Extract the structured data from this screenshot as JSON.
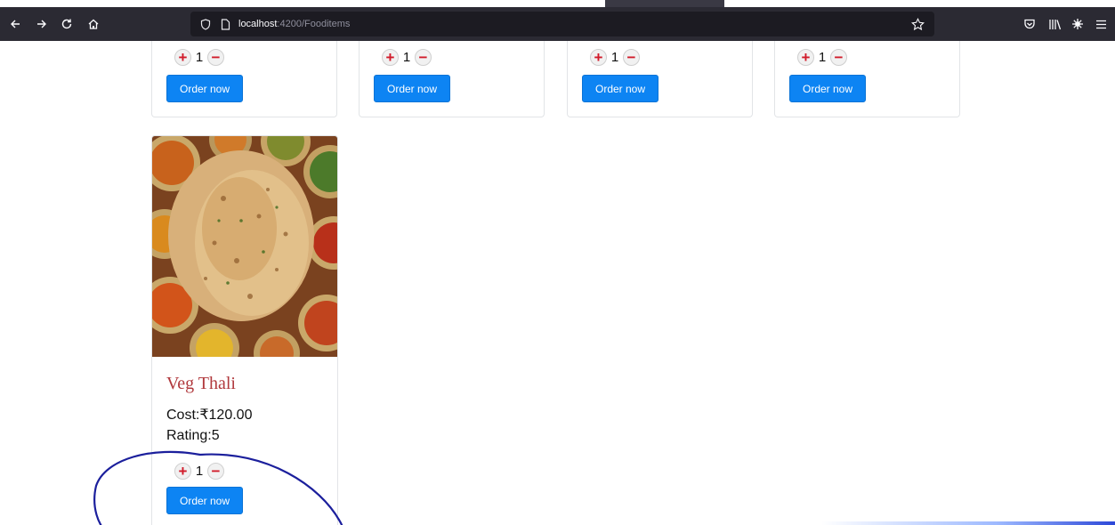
{
  "browser": {
    "url_host": "localhost",
    "url_rest": ":4200/Fooditems",
    "icons": {
      "back": "back-arrow-icon",
      "forward": "forward-arrow-icon",
      "reload": "reload-icon",
      "home": "home-icon",
      "tracking_protection": "shield-icon",
      "page_info": "page-icon",
      "bookmark": "star-icon",
      "pocket": "pocket-icon",
      "library": "library-icon",
      "extensions": "extension-icon",
      "menu": "hamburger-menu-icon"
    }
  },
  "top_cards": [
    {
      "qty_plus": "+",
      "qty_value": "1",
      "qty_minus": "−",
      "order_label": "Order now"
    },
    {
      "qty_plus": "+",
      "qty_value": "1",
      "qty_minus": "−",
      "order_label": "Order now"
    },
    {
      "qty_plus": "+",
      "qty_value": "1",
      "qty_minus": "−",
      "order_label": "Order now"
    },
    {
      "qty_plus": "+",
      "qty_value": "1",
      "qty_minus": "−",
      "order_label": "Order now"
    }
  ],
  "food_card": {
    "image": "veg-thali-photo",
    "name": "Veg Thali",
    "cost": "Cost:₹120.00",
    "rating": "Rating:5",
    "qty_plus": "+",
    "qty_value": "1",
    "qty_minus": "−",
    "order_label": "Order now"
  },
  "colors": {
    "order_button": "#0d84f3",
    "food_title": "#b1393d",
    "qty_icon": "#d11b2a",
    "annotation_stroke": "#1b1f9c",
    "browser_toolbar": "#2b2a33"
  }
}
